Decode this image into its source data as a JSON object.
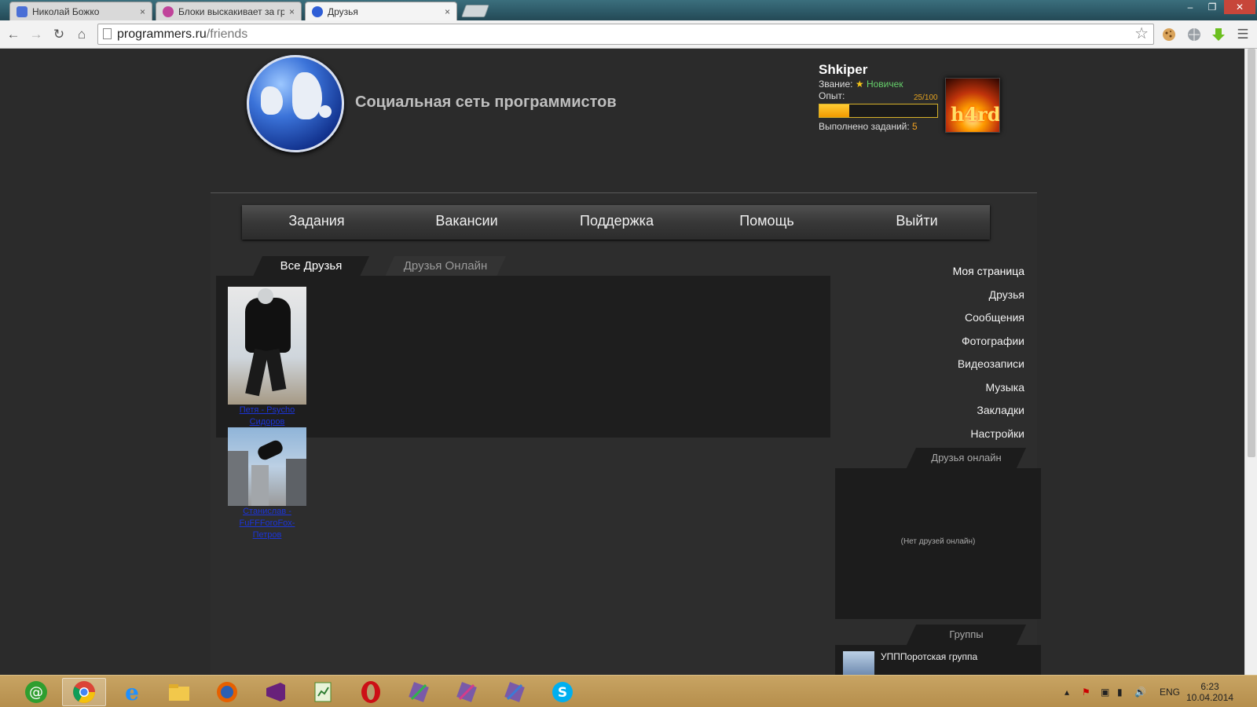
{
  "browser": {
    "tabs": [
      {
        "title": "Николай Божко",
        "favicon_color": "#4a6fd6"
      },
      {
        "title": "Блоки выскакивает за гр",
        "favicon_color": "#c0439a"
      },
      {
        "title": "Друзья",
        "favicon_color": "#2f5ed6"
      }
    ],
    "active_tab": 2,
    "close_glyph": "×",
    "window_buttons": {
      "minimize": "–",
      "maximize": "❐",
      "close": "✕"
    },
    "url_host": "programmers.ru",
    "url_path": "/friends",
    "icons": [
      "back-icon",
      "forward-icon",
      "reload-icon",
      "home-icon",
      "page-icon",
      "bookmark-star-icon",
      "cookie-icon",
      "globe-extension-icon",
      "download-arrow-icon",
      "menu-icon"
    ]
  },
  "site": {
    "title": "Социальная сеть программистов",
    "user": {
      "name": "Shkiper",
      "rank_label": "Звание:",
      "rank_value": "Новичек",
      "xp_label": "Опыт:",
      "xp_text": "25/100",
      "xp_fraction": 0.25,
      "tasks_label": "Выполнено заданий:",
      "tasks_value": "5",
      "avatar_text": "h4rd"
    },
    "nav": [
      "Задания",
      "Вакансии",
      "Поддержка",
      "Помощь",
      "Выйти"
    ],
    "friend_tabs": [
      {
        "label": "Все Друзья",
        "active": true
      },
      {
        "label": "Друзья Онлайн",
        "active": false
      }
    ],
    "friends": [
      {
        "name": "Петя - Psycho Сидоров"
      },
      {
        "name": "Станислав -FuFFForoFox- Петров"
      }
    ],
    "side_menu": [
      "Моя страница",
      "Друзья",
      "Сообщения",
      "Фотографии",
      "Видеозаписи",
      "Музыка",
      "Закладки",
      "Настройки"
    ],
    "online_header": "Друзья онлайн",
    "online_empty": "(Нет друзей онлайн)",
    "groups_header": "Группы",
    "groups": [
      {
        "name": "УПППоротская группа"
      }
    ]
  },
  "taskbar": {
    "apps": [
      "mail-agent-icon",
      "chrome-icon",
      "internet-explorer-icon",
      "file-explorer-icon",
      "firefox-icon",
      "visual-studio-icon",
      "spreadsheet-icon",
      "opera-icon",
      "tool-icon-1",
      "tool-icon-2",
      "tool-icon-3",
      "skype-icon"
    ],
    "active_app": 1,
    "lang": "ENG",
    "time": "6:23",
    "date": "10.04.2014"
  }
}
